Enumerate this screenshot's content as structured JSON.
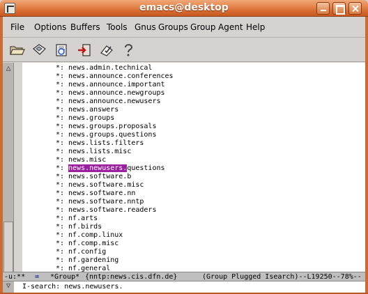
{
  "window": {
    "title": "emacs@desktop",
    "buttons": {
      "minimize": "minimize",
      "maximize": "maximize",
      "close": "close"
    }
  },
  "menubar": {
    "items": [
      "File",
      "Options",
      "Buffers",
      "Tools",
      "Gnus",
      "Groups",
      "Group",
      "Agent",
      "Help"
    ]
  },
  "toolbar": {
    "icons": [
      "open-folder-icon",
      "save-disk-icon",
      "refresh-icon",
      "exit-icon",
      "edit-check-icon",
      "help-icon"
    ]
  },
  "buffer": {
    "lines": [
      {
        "mark": "*:",
        "name": "news.admin.technical"
      },
      {
        "mark": "*:",
        "name": "news.announce.conferences"
      },
      {
        "mark": "*:",
        "name": "news.announce.important"
      },
      {
        "mark": "*:",
        "name": "news.announce.newgroups"
      },
      {
        "mark": "*:",
        "name": "news.announce.newusers"
      },
      {
        "mark": "*:",
        "name": "news.answers"
      },
      {
        "mark": "*:",
        "name": "news.groups"
      },
      {
        "mark": "*:",
        "name": "news.groups.proposals"
      },
      {
        "mark": "*:",
        "name": "news.groups.questions"
      },
      {
        "mark": "*:",
        "name": "news.lists.filters"
      },
      {
        "mark": "*:",
        "name": "news.lists.misc"
      },
      {
        "mark": "*:",
        "name": "news.misc"
      },
      {
        "mark": "*:",
        "name": "news.newusers.questions",
        "match": "news.newusers.",
        "rest": "questions"
      },
      {
        "mark": "*:",
        "name": "news.software.b"
      },
      {
        "mark": "*:",
        "name": "news.software.misc"
      },
      {
        "mark": "*:",
        "name": "news.software.nn"
      },
      {
        "mark": "*:",
        "name": "news.software.nntp"
      },
      {
        "mark": "*:",
        "name": "news.software.readers"
      },
      {
        "mark": "*:",
        "name": "nf.arts"
      },
      {
        "mark": "*:",
        "name": "nf.birds"
      },
      {
        "mark": "*:",
        "name": "nf.comp.linux"
      },
      {
        "mark": "*:",
        "name": "nf.comp.misc"
      },
      {
        "mark": "*:",
        "name": "nf.config"
      },
      {
        "mark": "*:",
        "name": "nf.gardening"
      },
      {
        "mark": "*:",
        "name": "nf.general"
      }
    ]
  },
  "modeline": {
    "status": "-u:**",
    "buffer_name": "*Group*",
    "server": "{nntp:news.cis.dfn.de}",
    "modes": "(Group Plugged Isearch)--L19250--78%--"
  },
  "minibuffer": {
    "prompt": "I-search: ",
    "query": "news.newusers."
  },
  "colors": {
    "titlebar": "#d66a30",
    "isearch_highlight": "#9c1fa0",
    "modeline_bg": "#bfbfbf"
  }
}
